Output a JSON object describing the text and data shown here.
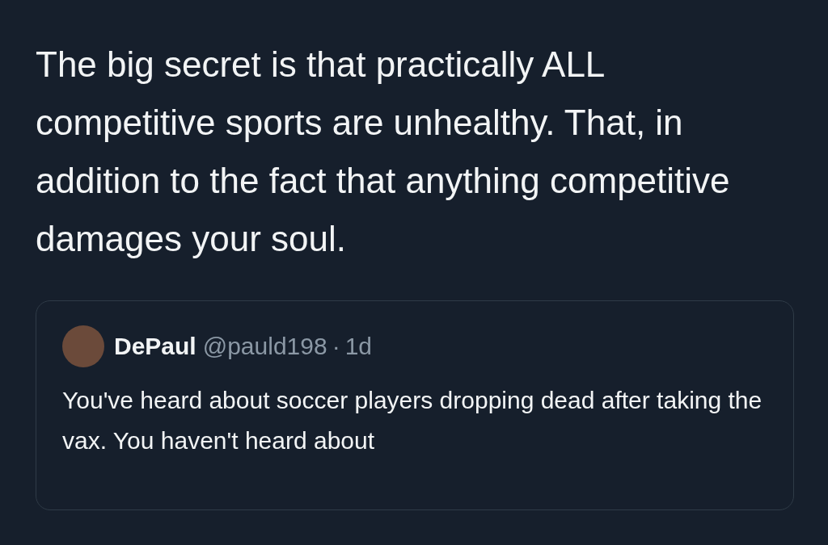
{
  "tweet": {
    "text": "The big secret is that practically ALL competitive sports are unhealthy. That, in addition to the fact that anything competitive damages your soul."
  },
  "quoted_tweet": {
    "name": "DePaul",
    "handle": "@pauld198",
    "separator": "·",
    "time": "1d",
    "text": "You've heard about soccer players dropping dead after taking the vax. You haven't heard about"
  }
}
